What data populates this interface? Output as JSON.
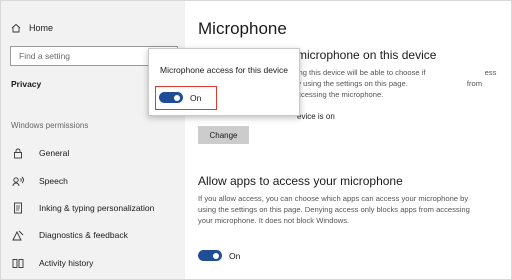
{
  "sidebar": {
    "home_label": "Home",
    "search_placeholder": "Find a setting",
    "category": "Privacy",
    "section_label": "Windows permissions",
    "items": [
      {
        "label": "General",
        "icon": "lock-icon"
      },
      {
        "label": "Speech",
        "icon": "speech-icon"
      },
      {
        "label": "Inking & typing personalization",
        "icon": "inking-icon"
      },
      {
        "label": "Diagnostics & feedback",
        "icon": "diagnostics-icon"
      },
      {
        "label": "Activity history",
        "icon": "activity-history-icon"
      }
    ]
  },
  "main": {
    "title": "Microphone",
    "section1_title": "microphone on this device",
    "section1_desc": "sing this device will be able to choose if                            ess by using the settings on this page.                            from accessing the microphone.",
    "section1_status": "evice is on",
    "change_label": "Change",
    "section2_title": "Allow apps to access your microphone",
    "section2_desc": "If you allow access, you can choose which apps can access your microphone by using the settings on this page. Denying access only blocks apps from accessing your microphone. It does not block Windows.",
    "section2_toggle_label": "On",
    "section2_toggle_on": true
  },
  "popup": {
    "text": "Microphone access for this device",
    "toggle_label": "On",
    "toggle_on": true
  },
  "colors": {
    "accent": "#1f4e96",
    "highlight": "#e03a30",
    "sidebar_bg": "#f2f2f2"
  }
}
